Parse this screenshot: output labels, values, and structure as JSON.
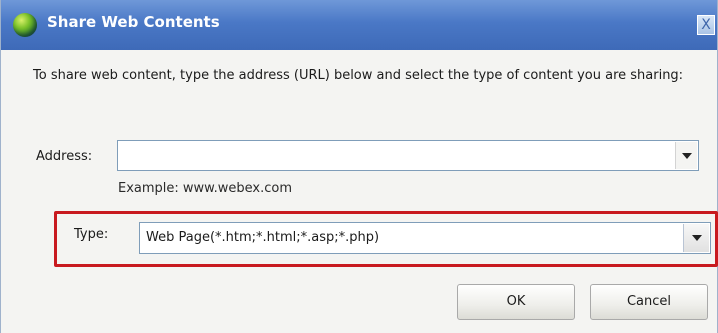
{
  "window": {
    "title": "Share Web Contents",
    "close_label": "X"
  },
  "instructions": "To share web content, type the address (URL) below and select the type of content you are sharing:",
  "address": {
    "label": "Address:",
    "value": "",
    "example": "Example: www.webex.com"
  },
  "type": {
    "label": "Type:",
    "selected": "Web Page(*.htm;*.html;*.asp;*.php)"
  },
  "buttons": {
    "ok": "OK",
    "cancel": "Cancel"
  },
  "icons": {
    "app": "globe-icon",
    "close": "close-icon",
    "dropdown": "chevron-down-icon"
  },
  "colors": {
    "title_bar": "#4a78c6",
    "highlight": "#c81a1f"
  }
}
